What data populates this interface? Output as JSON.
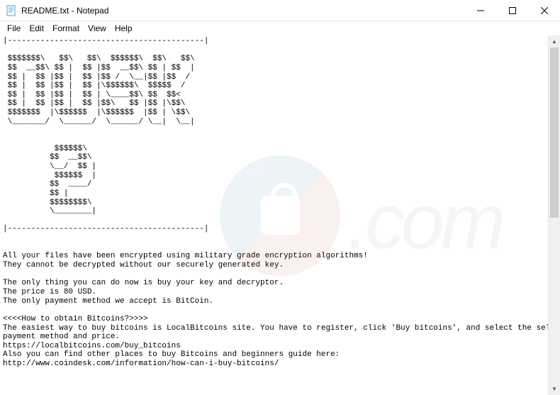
{
  "window": {
    "title": "README.txt - Notepad",
    "icon": "notepad-icon"
  },
  "menubar": {
    "file": "File",
    "edit": "Edit",
    "format": "Format",
    "view": "View",
    "help": "Help"
  },
  "content": {
    "text": "|------------------------------------------|\n\n $$$$$$$\\   $$\\   $$\\  $$$$$$\\  $$\\   $$\\\n $$  __$$\\ $$ |  $$ |$$  __$$\\ $$ | $$  |\n $$ |  $$ |$$ |  $$ |$$ /  \\__|$$ |$$  /\n $$ |  $$ |$$ |  $$ |\\$$$$$$\\  $$$$$  /\n $$ |  $$ |$$ |  $$ | \\____$$\\ $$  $$<\n $$ |  $$ |$$ |  $$ |$$\\   $$ |$$ |\\$$\\\n $$$$$$$  |\\$$$$$$  |\\$$$$$$  |$$ | \\$$\\\n \\_______/  \\______/  \\______/ \\__|  \\__|\n\n\n           $$$$$$\\\n          $$  __$$\\\n          \\__/  $$ |\n           $$$$$$  |\n          $$  ____/\n          $$ |\n          $$$$$$$$\\\n          \\________|\n\n|------------------------------------------|\n\n\nAll your files have been encrypted using military grade encryption algorithms!\nThey cannot be decrypted without our securely generated key.\n\nThe only thing you can do now is buy your key and decryptor.\nThe price is 80 USD.\nThe only payment method we accept is BitCoin.\n\n<<<<How to obtain Bitcoins?>>>>\nThe easiest way to buy bitcoins is LocalBitcoins site. You have to register, click 'Buy bitcoins', and select the seller by\npayment method and price.\nhttps://localbitcoins.com/buy_bitcoins\nAlso you can find other places to buy Bitcoins and beginners guide here:\nhttp://www.coindesk.com/information/how-can-i-buy-bitcoins/"
  },
  "watermark": {
    "text": ".com"
  }
}
